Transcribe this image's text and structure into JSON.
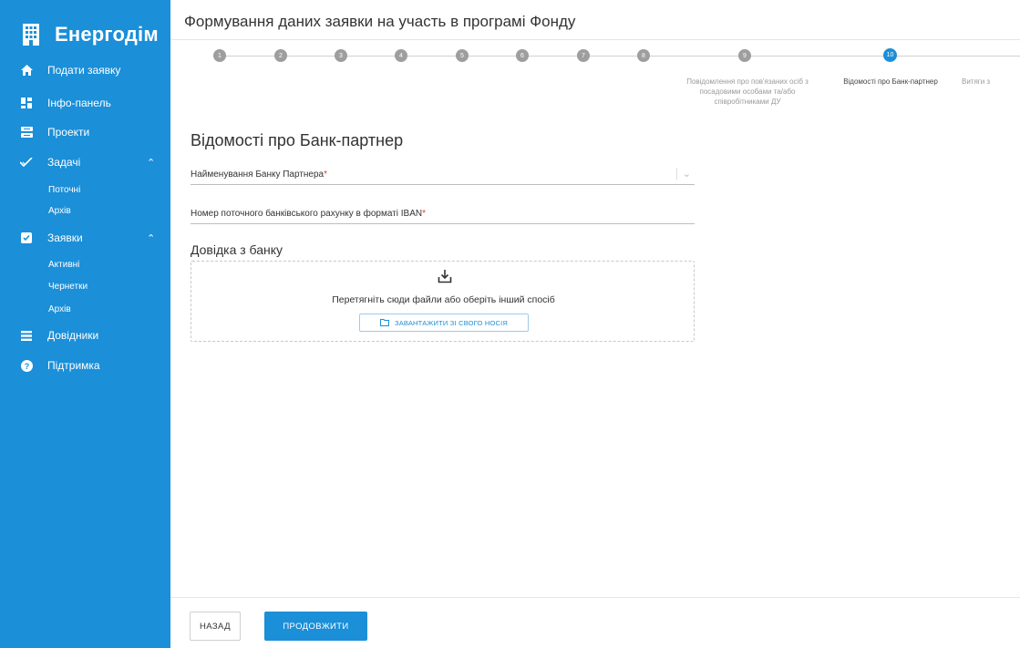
{
  "colors": {
    "brand": "#1b8fd8",
    "required": "#e53935",
    "step_inactive": "#9e9e9e"
  },
  "sidebar": {
    "brand": "Енергодім",
    "items": [
      {
        "label": "Подати заявку",
        "icon": "home-icon"
      },
      {
        "label": "Інфо-панель",
        "icon": "dashboard-icon"
      },
      {
        "label": "Проекти",
        "icon": "projects-icon"
      },
      {
        "label": "Задачі",
        "icon": "check-icon",
        "sub": [
          "Поточні",
          "Архів"
        ]
      },
      {
        "label": "Заявки",
        "icon": "checkbox-icon",
        "sub": [
          "Активні",
          "Чернетки",
          "Архів"
        ]
      },
      {
        "label": "Довідники",
        "icon": "list-icon"
      },
      {
        "label": "Підтримка",
        "icon": "help-icon"
      }
    ]
  },
  "header": {
    "title": "Формування даних заявки на участь в програмі Фонду"
  },
  "stepper": {
    "steps": [
      "1",
      "2",
      "3",
      "4",
      "5",
      "6",
      "7",
      "8",
      "9",
      "10"
    ],
    "current": 10,
    "labels": {
      "step9": "Повідомлення про пов'язаних осіб з посадовими особами та/або співробітниками ДУ",
      "step10": "Відомості про Банк-партнер",
      "step11": "Витяги з"
    }
  },
  "form": {
    "section_title": "Відомості про Банк-партнер",
    "bank_name_label": "Найменування Банку Партнера",
    "iban_label": "Номер поточного банківського рахунку в форматі IBAN",
    "required_mark": "*",
    "certificate_title": "Довідка з банку",
    "dropzone_text": "Перетягніть сюди файли або оберіть інший спосіб",
    "upload_button": "ЗАВАНТАЖИТИ ЗІ СВОГО НОСІЯ"
  },
  "footer": {
    "back_label": "НАЗАД",
    "next_label": "ПРОДОВЖИТИ"
  }
}
